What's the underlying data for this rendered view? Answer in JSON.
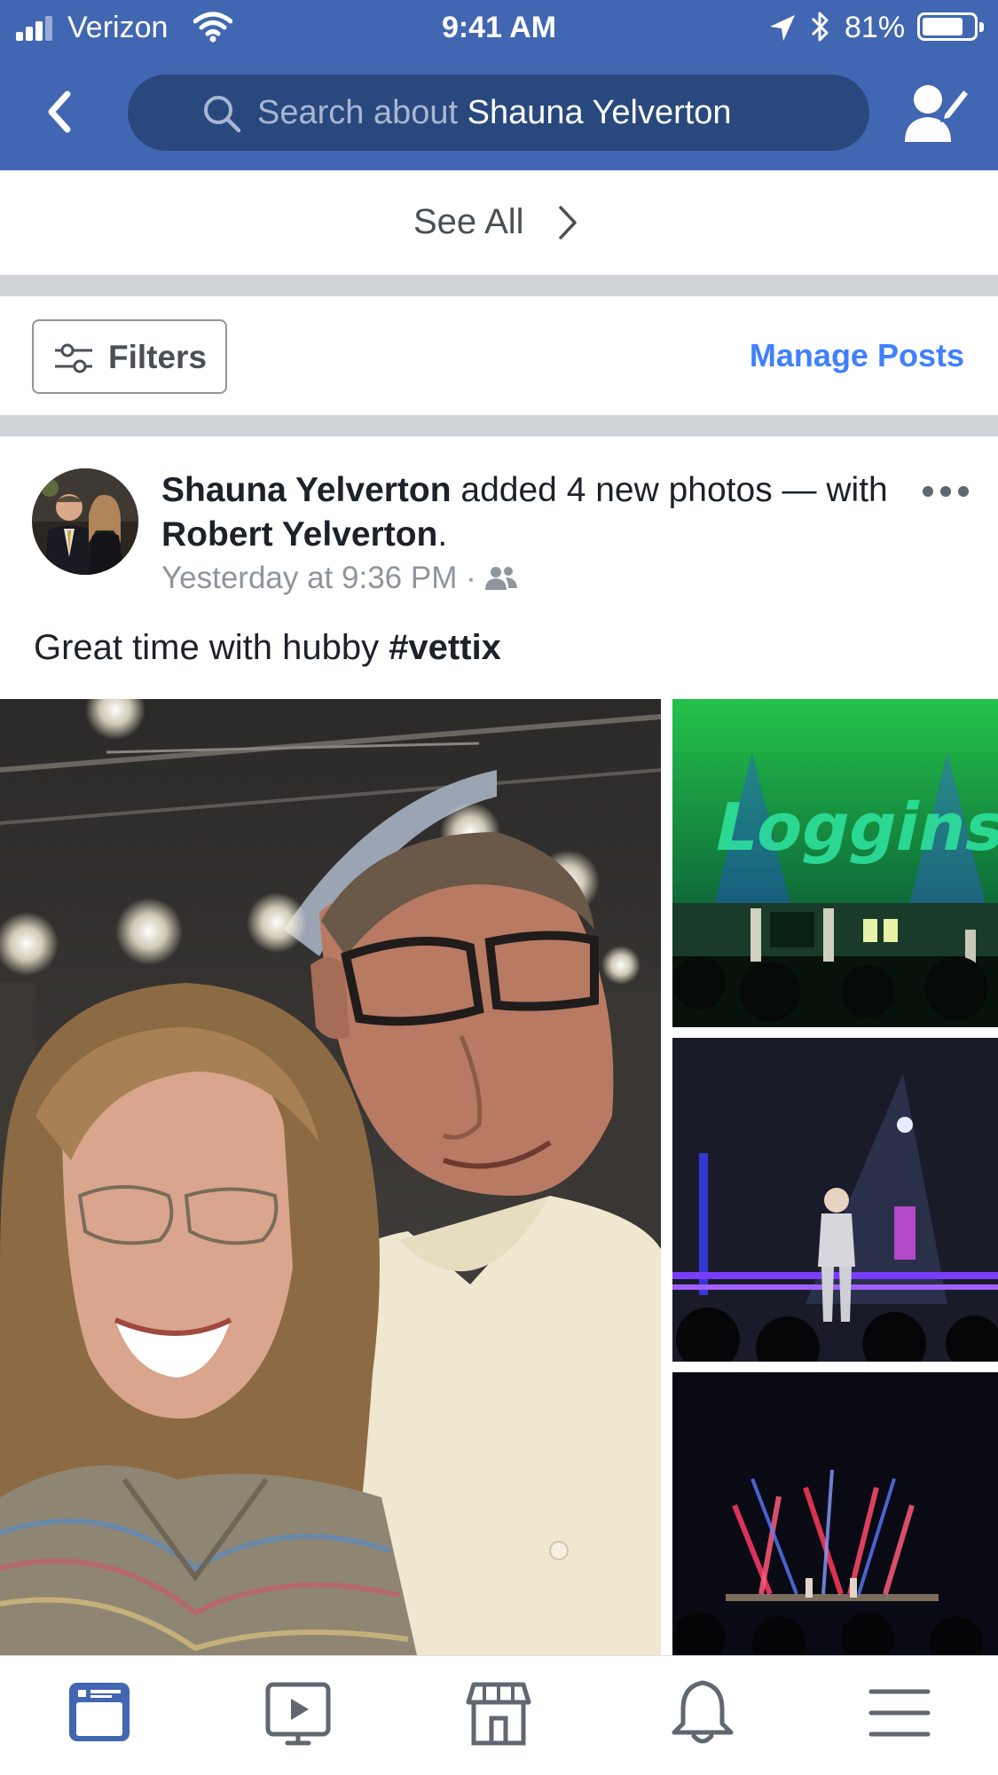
{
  "status_bar": {
    "carrier": "Verizon",
    "time": "9:41 AM",
    "battery_percent": "81%",
    "battery_level": 0.81
  },
  "header": {
    "search_placeholder": "Search about",
    "search_name": "Shauna Yelverton",
    "accent_color": "#4267b2"
  },
  "see_all": {
    "label": "See All"
  },
  "filters": {
    "label": "Filters",
    "manage_label": "Manage Posts",
    "manage_color": "#4080ff"
  },
  "post": {
    "author": "Shauna Yelverton",
    "action_text": " added 4 new photos — with ",
    "tagged": "Robert Yelverton",
    "end_punct": ".",
    "timestamp": "Yesterday at 9:36 PM",
    "separator": " · ",
    "audience_icon": "friends-icon",
    "text_prefix": "Great time with hubby ",
    "hashtag": "#vettix"
  },
  "tabs": [
    {
      "icon": "news-feed-icon",
      "active": true
    },
    {
      "icon": "watch-video-icon",
      "active": false
    },
    {
      "icon": "marketplace-icon",
      "active": false
    },
    {
      "icon": "notifications-bell-icon",
      "active": false
    },
    {
      "icon": "menu-icon",
      "active": false
    }
  ]
}
